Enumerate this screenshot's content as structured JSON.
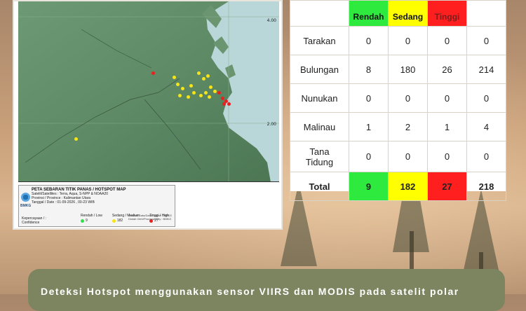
{
  "map": {
    "coord_top": "4.00",
    "coord_mid": "2.00",
    "legend": {
      "title": "PETA SEBARAN TITIK PANAS / HOTSPOT MAP",
      "satellite": "Satelit/Satellites : Terra, Aqua, S-NPP & NOAA20",
      "province": "Provinsi / Province : Kalimantan Utara",
      "date": "Tanggal / Date : 01-09-2026 , 00-23 WIB",
      "confidence_label": "Kepercayaan / :",
      "confidence_label2": "Confidence",
      "logo_text": "BMKG",
      "items": [
        {
          "label": "Rendah / Low",
          "value": "9",
          "color": "#2ee24a"
        },
        {
          "label": "Sedang / Medium",
          "value": "182",
          "color": "#f5e51a"
        },
        {
          "label": "Tinggi / High",
          "value": "27",
          "color": "#e82020"
        }
      ],
      "notes": [
        "Sumber Data/Data Source : BMKG",
        "Diolah Oleh/Processed by : BMKG"
      ]
    }
  },
  "table": {
    "headers": [
      "",
      "Rendah",
      "Sedang",
      "Tinggi",
      ""
    ],
    "rows": [
      {
        "region": "Tarakan",
        "rendah": "0",
        "sedang": "0",
        "tinggi": "0",
        "total": "0"
      },
      {
        "region": "Bulungan",
        "rendah": "8",
        "sedang": "180",
        "tinggi": "26",
        "total": "214"
      },
      {
        "region": "Nunukan",
        "rendah": "0",
        "sedang": "0",
        "tinggi": "0",
        "total": "0"
      },
      {
        "region": "Malinau",
        "rendah": "1",
        "sedang": "2",
        "tinggi": "1",
        "total": "4"
      },
      {
        "region": "Tana Tidung",
        "rendah": "0",
        "sedang": "0",
        "tinggi": "0",
        "total": "0"
      }
    ],
    "total": {
      "label": "Total",
      "rendah": "9",
      "sedang": "182",
      "tinggi": "27",
      "total": "218"
    }
  },
  "colors": {
    "rendah": "#2eea3e",
    "sedang": "#ffff00",
    "tinggi": "#ff1f1f",
    "caption_bg": "#7c8560"
  },
  "caption": "Deteksi Hotspot menggunakan sensor VIIRS dan MODIS pada satelit polar"
}
